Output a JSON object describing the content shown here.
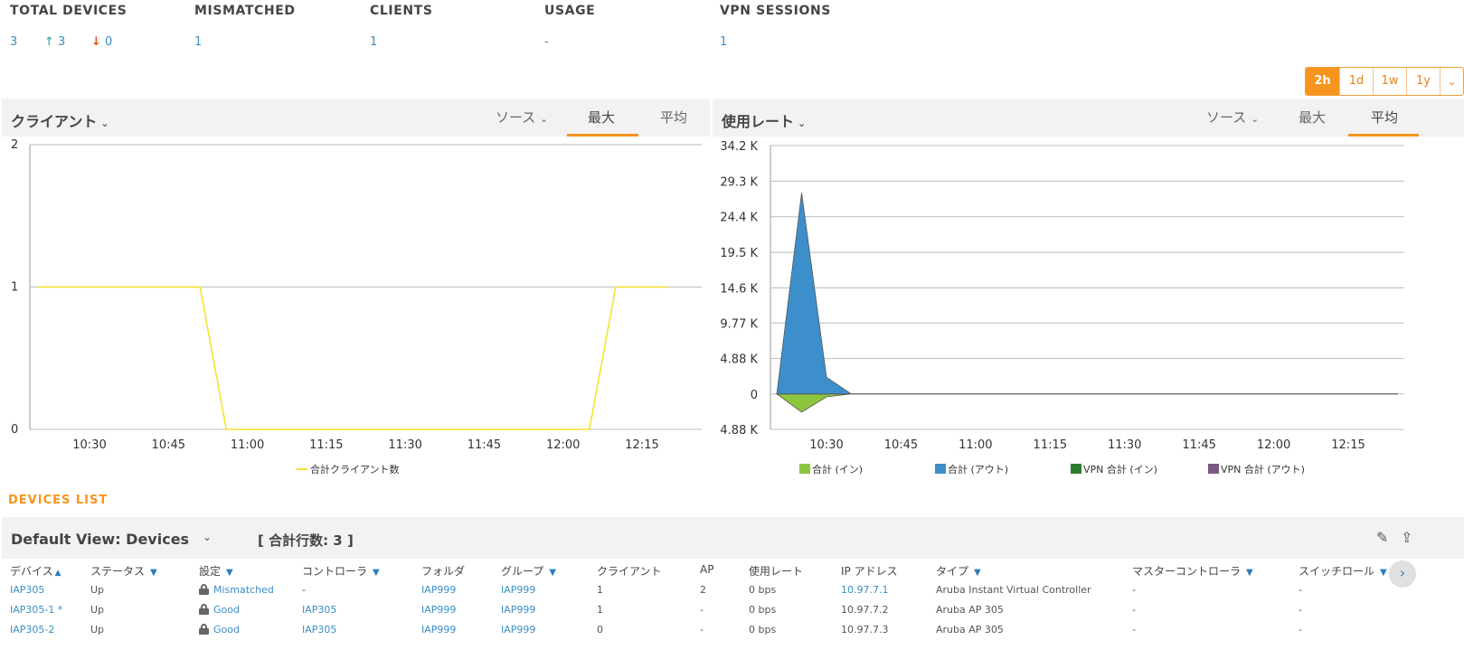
{
  "summary": {
    "total_devices_label": "TOTAL DEVICES",
    "total_devices": "3",
    "up_arrow": "↑",
    "up_count": "3",
    "down_arrow": "↓",
    "down_count": "0",
    "mismatched_label": "MISMATCHED",
    "mismatched": "1",
    "clients_label": "CLIENTS",
    "clients": "1",
    "usage_label": "USAGE",
    "usage": "-",
    "vpn_label": "VPN SESSIONS",
    "vpn": "1"
  },
  "time_range": {
    "options": [
      "2h",
      "1d",
      "1w",
      "1y"
    ],
    "selected": "2h",
    "more_icon": "chevron-down-icon",
    "more": "⌄"
  },
  "clients_panel": {
    "title": "クライアント",
    "source_label": "ソース",
    "tab_max": "最大",
    "tab_avg": "平均",
    "active_tab": "最大",
    "chart_data": {
      "type": "line",
      "x_ticks": [
        "10:30",
        "10:45",
        "11:00",
        "11:15",
        "11:30",
        "11:45",
        "12:00",
        "12:15"
      ],
      "y_ticks": [
        "0",
        "1",
        "2"
      ],
      "ylim": [
        0,
        2
      ],
      "series": [
        {
          "name": "合計クライアント数",
          "color": "#f5e027",
          "points": [
            [
              "10:20",
              1
            ],
            [
              "10:51",
              1
            ],
            [
              "10:56",
              0
            ],
            [
              "12:05",
              0
            ],
            [
              "12:10",
              1
            ],
            [
              "12:20",
              1
            ]
          ]
        }
      ]
    }
  },
  "usage_panel": {
    "title": "使用レート",
    "source_label": "ソース",
    "tab_max": "最大",
    "tab_avg": "平均",
    "active_tab": "平均",
    "chart_data": {
      "type": "area",
      "x_ticks": [
        "10:30",
        "10:45",
        "11:00",
        "11:15",
        "11:30",
        "11:45",
        "12:00",
        "12:15"
      ],
      "y_ticks": [
        "34.2 K",
        "29.3 K",
        "24.4 K",
        "19.5 K",
        "14.6 K",
        "9.77 K",
        "4.88 K",
        "0",
        "4.88 K"
      ],
      "ylim": [
        -4880,
        34200
      ],
      "series": [
        {
          "name": "合計 (イン)",
          "color": "#8cc63f",
          "points": [
            [
              "10:20",
              0
            ],
            [
              "10:25",
              -2500
            ],
            [
              "10:30",
              -400
            ],
            [
              "10:35",
              0
            ],
            [
              "12:25",
              0
            ]
          ]
        },
        {
          "name": "合計 (アウト)",
          "color": "#3d8fcc",
          "points": [
            [
              "10:20",
              0
            ],
            [
              "10:25",
              27700
            ],
            [
              "10:30",
              2300
            ],
            [
              "10:35",
              0
            ],
            [
              "12:25",
              0
            ]
          ]
        },
        {
          "name": "VPN 合計 (イン)",
          "color": "#2e7d2e",
          "points": []
        },
        {
          "name": "VPN 合計 (アウト)",
          "color": "#7b5a82",
          "points": []
        }
      ]
    }
  },
  "devices": {
    "section_title": "DEVICES LIST",
    "view_label": "Default View: Devices",
    "row_count_label": "[ 合計行数: 3 ]",
    "edit_icon": "✎",
    "export_icon": "⇪",
    "scroll_icon": "›",
    "columns": [
      "デバイス",
      "ステータス",
      "設定",
      "コントローラ",
      "フォルダ",
      "グループ",
      "クライアント",
      "AP",
      "使用レート",
      "IP アドレス",
      "タイプ",
      "マスターコントローラ",
      "スイッチロール"
    ],
    "sort_indicator": "▲",
    "filter_icon": "▼",
    "rows": [
      [
        "IAP305",
        "Up",
        "Mismatched",
        "-",
        "IAP999",
        "IAP999",
        "1",
        "2",
        "0 bps",
        "10.97.7.1",
        "Aruba Instant Virtual Controller",
        "-",
        "-"
      ],
      [
        "IAP305-1 *",
        "Up",
        "Good",
        "IAP305",
        "IAP999",
        "IAP999",
        "1",
        "-",
        "0 bps",
        "10.97.7.2",
        "Aruba AP 305",
        "-",
        "-"
      ],
      [
        "IAP305-2",
        "Up",
        "Good",
        "IAP305",
        "IAP999",
        "IAP999",
        "0",
        "-",
        "0 bps",
        "10.97.7.3",
        "Aruba AP 305",
        "-",
        "-"
      ]
    ]
  }
}
